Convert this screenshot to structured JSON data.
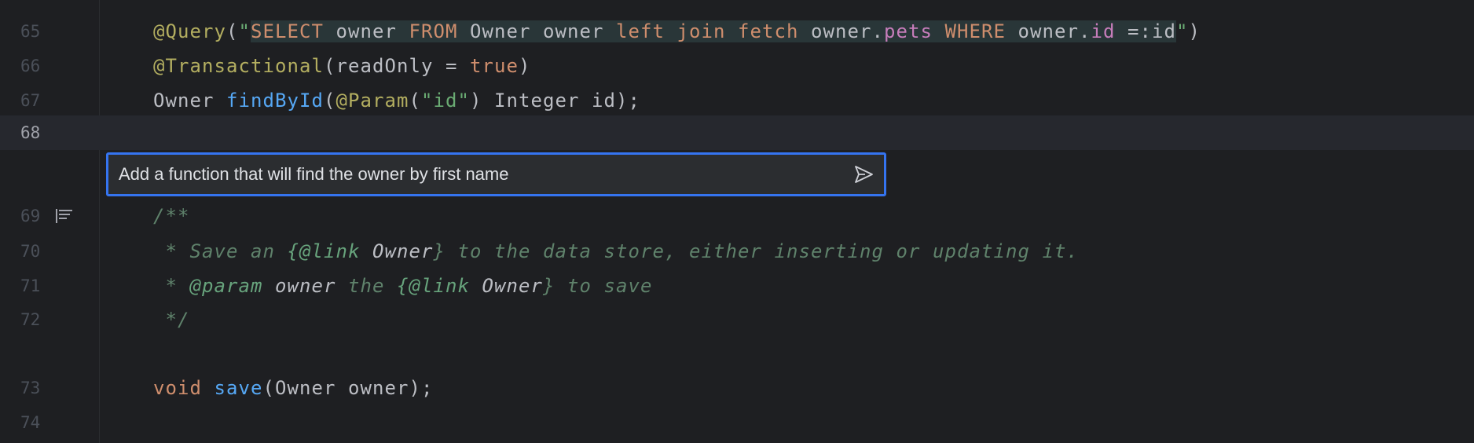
{
  "editor": {
    "current_line": "68",
    "lines": [
      {
        "num": "65",
        "tokens": [
          [
            "@Query",
            "a"
          ],
          [
            "(",
            ""
          ],
          [
            "\"",
            "s"
          ],
          [
            "SELECT",
            "k inj"
          ],
          [
            " owner ",
            "inj"
          ],
          [
            "FROM",
            "k inj"
          ],
          [
            " Owner owner ",
            "inj"
          ],
          [
            "left join fetch",
            "k inj"
          ],
          [
            " owner.",
            "inj"
          ],
          [
            "pets",
            "p inj"
          ],
          [
            " ",
            "inj"
          ],
          [
            "WHERE",
            "k inj"
          ],
          [
            " owner.",
            "inj"
          ],
          [
            "id",
            "p inj"
          ],
          [
            " =:id",
            "inj"
          ],
          [
            "\"",
            "s"
          ],
          [
            ")",
            ""
          ]
        ]
      },
      {
        "num": "66",
        "tokens": [
          [
            "@Transactional",
            "a"
          ],
          [
            "(readOnly = ",
            ""
          ],
          [
            "true",
            "k"
          ],
          [
            ")",
            ""
          ]
        ]
      },
      {
        "num": "67",
        "tokens": [
          [
            "Owner ",
            ""
          ],
          [
            "findById",
            "m"
          ],
          [
            "(",
            ""
          ],
          [
            "@Param",
            "a"
          ],
          [
            "(",
            ""
          ],
          [
            "\"id\"",
            "s"
          ],
          [
            ") Integer id);",
            ""
          ]
        ]
      },
      {
        "num": "68",
        "tokens": []
      },
      {
        "num": "69",
        "tokens": [
          [
            "/**",
            "c"
          ]
        ],
        "icon": "rendered-doc-icon"
      },
      {
        "num": "70",
        "tokens": [
          [
            " * Save an ",
            "c"
          ],
          [
            "{@link",
            "dt"
          ],
          [
            " Owner",
            "dr"
          ],
          [
            "}",
            "c"
          ],
          [
            " to the data store, either inserting or updating it.",
            "c"
          ]
        ]
      },
      {
        "num": "71",
        "tokens": [
          [
            " * ",
            "c"
          ],
          [
            "@param",
            "dt"
          ],
          [
            " owner",
            "dr"
          ],
          [
            " the ",
            "c"
          ],
          [
            "{@link",
            "dt"
          ],
          [
            " Owner",
            "dr"
          ],
          [
            "}",
            "c"
          ],
          [
            " to save",
            "c"
          ]
        ]
      },
      {
        "num": "72",
        "tokens": [
          [
            " */",
            "c"
          ]
        ]
      },
      {
        "num": "73",
        "tokens": [
          [
            "void",
            "k"
          ],
          [
            " ",
            ""
          ],
          [
            "save",
            "m"
          ],
          [
            "(Owner owner);",
            ""
          ]
        ]
      },
      {
        "num": "74",
        "tokens": []
      }
    ]
  },
  "ai_prompt": {
    "value": "Add a function that will find the owner by first name",
    "send_icon": "send-icon"
  },
  "colors": {
    "accent": "#3574f0",
    "background": "#1e1f22"
  }
}
